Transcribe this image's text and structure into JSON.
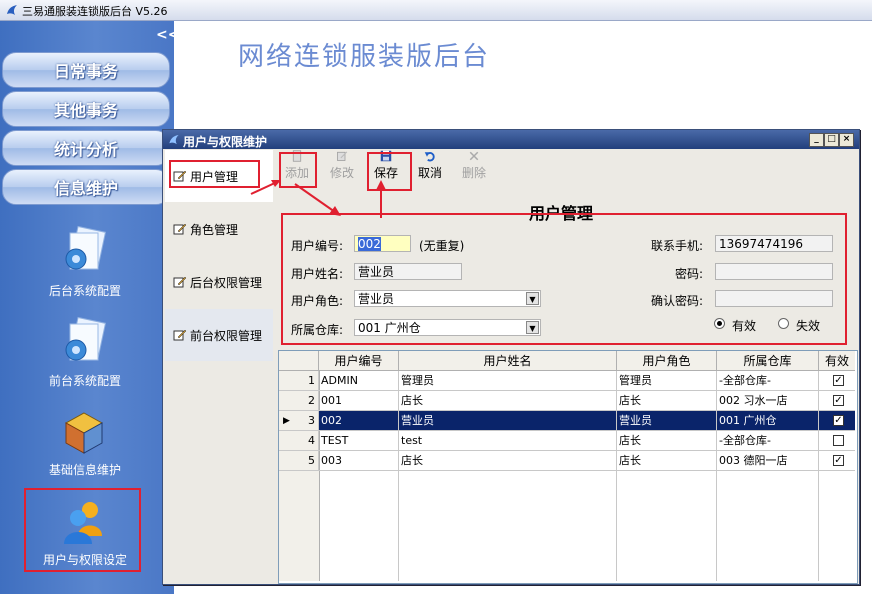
{
  "app": {
    "title": "三易通服装连锁版后台  V5.26"
  },
  "main": {
    "banner_title": "网络连锁服装版后台"
  },
  "leftnav": {
    "collapse_glyph": "<<",
    "menus": [
      "日常事务",
      "其他事务",
      "统计分析",
      "信息维护"
    ],
    "modules": [
      {
        "label": "后台系统配置",
        "icon": "gear-doc-icon"
      },
      {
        "label": "前台系统配置",
        "icon": "gear-doc-icon"
      },
      {
        "label": "基础信息维护",
        "icon": "cubes-icon"
      },
      {
        "label": "用户与权限设定",
        "icon": "users-icon"
      }
    ]
  },
  "window": {
    "title": "用户与权限维护",
    "controls": {
      "minimize": "_",
      "maximize": "□",
      "close": "×"
    },
    "tabs": [
      "用户管理",
      "角色管理",
      "后台权限管理",
      "前台权限管理"
    ],
    "toolbar": {
      "add": "添加",
      "edit": "修改",
      "save": "保存",
      "cancel": "取消",
      "delete": "删除"
    },
    "form": {
      "title": "用户管理",
      "user_id_label": "用户编号:",
      "user_id_value": "002",
      "user_id_hint": "(无重复)",
      "user_name_label": "用户姓名:",
      "user_name_value": "营业员",
      "user_role_label": "用户角色:",
      "user_role_value": "营业员",
      "warehouse_label": "所属仓库:",
      "warehouse_value": "001 广州仓",
      "phone_label": "联系手机:",
      "phone_value": "13697474196",
      "password_label": "密码:",
      "password_value": "",
      "confirm_label": "确认密码:",
      "confirm_value": "",
      "valid_label": "有效",
      "invalid_label": "失效",
      "status": "valid"
    },
    "grid": {
      "columns": [
        "用户编号",
        "用户姓名",
        "用户角色",
        "所属仓库",
        "有效"
      ],
      "rows": [
        {
          "num": "1",
          "id": "ADMIN",
          "name": "管理员",
          "role": "管理员",
          "warehouse": "-全部仓库-",
          "valid": "✓"
        },
        {
          "num": "2",
          "id": "001",
          "name": "店长",
          "role": "店长",
          "warehouse": "002 习水一店",
          "valid": "✓"
        },
        {
          "num": "3",
          "id": "002",
          "name": "营业员",
          "role": "营业员",
          "warehouse": "001 广州仓",
          "valid": "✓"
        },
        {
          "num": "4",
          "id": "TEST",
          "name": "test",
          "role": "店长",
          "warehouse": "-全部仓库-",
          "valid": ""
        },
        {
          "num": "5",
          "id": "003",
          "name": "店长",
          "role": "店长",
          "warehouse": "003 德阳一店",
          "valid": "✓"
        }
      ],
      "selected_row_marker": "▶"
    }
  },
  "colors": {
    "highlight_red": "#e02030",
    "nav_blue": "#4a77c6",
    "selected_row": "#0a246a"
  }
}
